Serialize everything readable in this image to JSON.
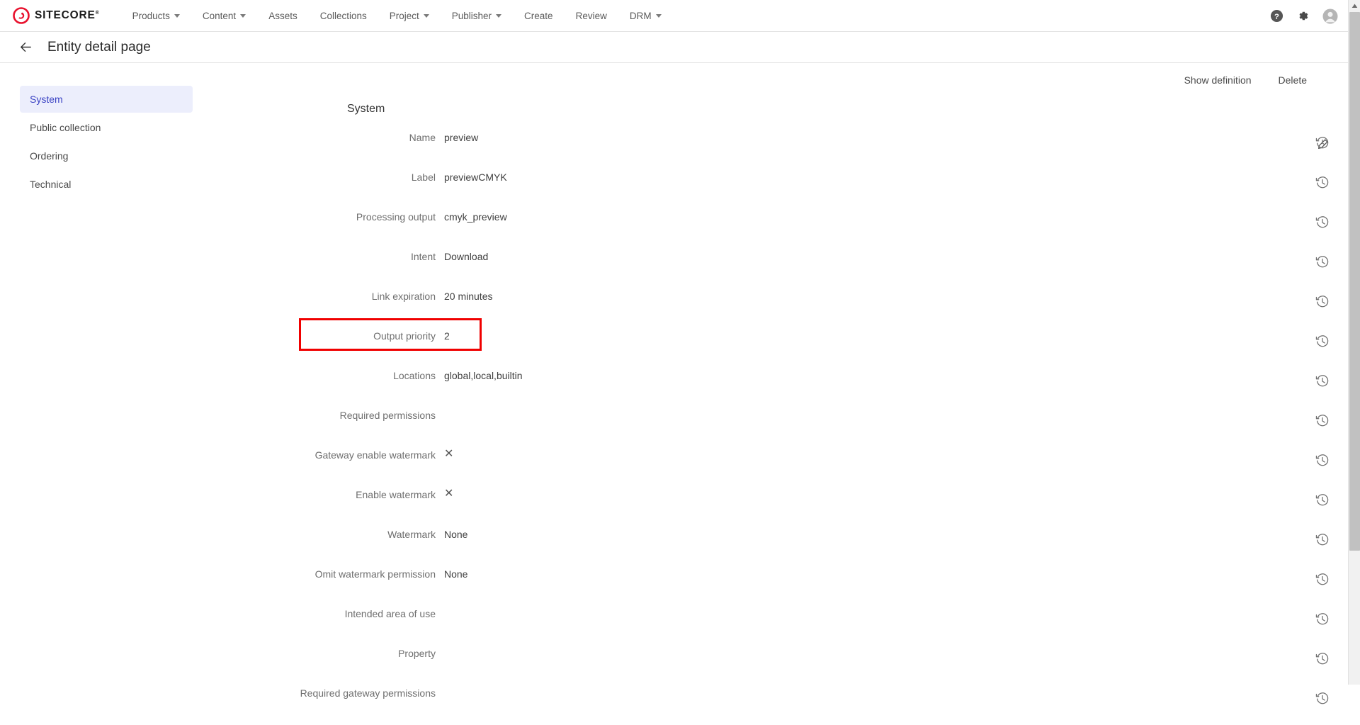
{
  "topnav": {
    "brand": "SITECORE",
    "brand_tm": "®",
    "brand_color": "#e8112d",
    "items": [
      {
        "label": "Products",
        "has_caret": true,
        "name": "nav-item-products"
      },
      {
        "label": "Content",
        "has_caret": true,
        "name": "nav-item-content"
      },
      {
        "label": "Assets",
        "has_caret": false,
        "name": "nav-item-assets"
      },
      {
        "label": "Collections",
        "has_caret": false,
        "name": "nav-item-collections"
      },
      {
        "label": "Project",
        "has_caret": true,
        "name": "nav-item-project"
      },
      {
        "label": "Publisher",
        "has_caret": true,
        "name": "nav-item-publisher"
      },
      {
        "label": "Create",
        "has_caret": false,
        "name": "nav-item-create"
      },
      {
        "label": "Review",
        "has_caret": false,
        "name": "nav-item-review"
      },
      {
        "label": "DRM",
        "has_caret": true,
        "name": "nav-item-drm"
      }
    ],
    "right_icons": [
      "help-icon",
      "gear-icon",
      "user-avatar-icon"
    ]
  },
  "pageheader": {
    "back_icon": "arrow-left-icon",
    "title": "Entity detail page"
  },
  "sidebar": {
    "items": [
      {
        "label": "System",
        "active": true
      },
      {
        "label": "Public collection",
        "active": false
      },
      {
        "label": "Ordering",
        "active": false
      },
      {
        "label": "Technical",
        "active": false
      }
    ]
  },
  "actions": {
    "show_definition": "Show definition",
    "delete": "Delete"
  },
  "main": {
    "section_title": "System",
    "edit_icon": "pencil-icon",
    "history_icon": "history-icon",
    "rows": [
      {
        "label": "Name",
        "value": "preview",
        "type": "text",
        "history": true
      },
      {
        "label": "Label",
        "value": "previewCMYK",
        "type": "text",
        "history": true
      },
      {
        "label": "Processing output",
        "value": "cmyk_preview",
        "type": "text",
        "history": true
      },
      {
        "label": "Intent",
        "value": "Download",
        "type": "text",
        "history": true
      },
      {
        "label": "Link expiration",
        "value": "20 minutes",
        "type": "text",
        "history": true
      },
      {
        "label": "Output priority",
        "value": "2",
        "type": "text",
        "history": true,
        "highlighted": true
      },
      {
        "label": "Locations",
        "value": "global,local,builtin",
        "type": "text",
        "history": true
      },
      {
        "label": "Required permissions",
        "value": "",
        "type": "text",
        "history": true
      },
      {
        "label": "Gateway enable watermark",
        "value": "✕",
        "type": "xmark",
        "history": true
      },
      {
        "label": "Enable watermark",
        "value": "✕",
        "type": "xmark",
        "history": true
      },
      {
        "label": "Watermark",
        "value": "None",
        "type": "text",
        "history": true
      },
      {
        "label": "Omit watermark permission",
        "value": "None",
        "type": "text",
        "history": true
      },
      {
        "label": "Intended area of use",
        "value": "",
        "type": "text",
        "history": true
      },
      {
        "label": "Property",
        "value": "",
        "type": "text",
        "history": true
      },
      {
        "label": "Required gateway permissions",
        "value": "",
        "type": "text",
        "history": true
      }
    ]
  },
  "annotation": {
    "target_row_label": "Output priority",
    "color": "#f00000"
  },
  "scrollbar": {
    "up_arrow": "scroll-up-arrow-icon",
    "position_label": "near-top"
  }
}
